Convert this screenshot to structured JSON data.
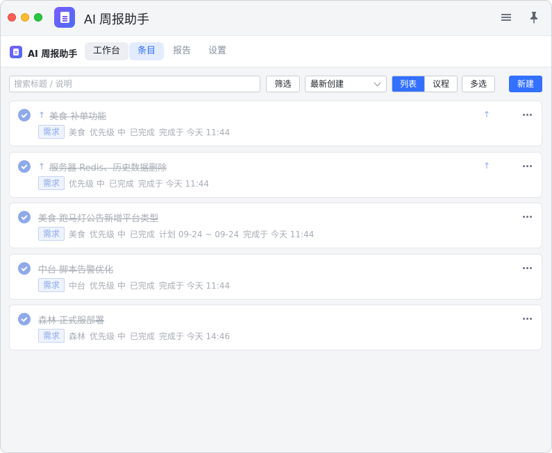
{
  "window": {
    "title": "AI 周报助手"
  },
  "nav": {
    "brand": "AI 周报助手",
    "tabs": [
      {
        "label": "工作台"
      },
      {
        "label": "条目"
      },
      {
        "label": "报告"
      },
      {
        "label": "设置"
      }
    ],
    "active_tab": "条目"
  },
  "toolbar": {
    "search_placeholder": "搜索标题 / 说明",
    "search_value": "",
    "filter_label": "筛选",
    "sort_value": "最新创建",
    "view_list_label": "列表",
    "view_agenda_label": "议程",
    "active_view": "列表",
    "multi_select_label": "多选",
    "new_label": "新建"
  },
  "colors": {
    "accent": "#3370ff",
    "completed_check": "#8fa9ea",
    "muted_text": "#a8adb5"
  },
  "items": [
    {
      "title": "美食 补单功能",
      "pinned": true,
      "tag": "需求",
      "meta": [
        "美食",
        "优先级 中",
        "已完成",
        "完成于 今天 11:44"
      ]
    },
    {
      "title": "服务器 Redis、历史数据删除",
      "pinned": true,
      "tag": "需求",
      "meta": [
        "优先级 中",
        "已完成",
        "完成于 今天 11:44"
      ]
    },
    {
      "title": "美食 跑马灯公告新增平台类型",
      "pinned": false,
      "tag": "需求",
      "meta": [
        "美食",
        "优先级 中",
        "已完成",
        "计划 09-24 ~ 09-24",
        "完成于 今天 11:44"
      ]
    },
    {
      "title": "中台 脚本告警优化",
      "pinned": false,
      "tag": "需求",
      "meta": [
        "中台",
        "优先级 中",
        "已完成",
        "完成于 今天 11:44"
      ]
    },
    {
      "title": "森林 正式服部署",
      "pinned": false,
      "tag": "需求",
      "meta": [
        "森林",
        "优先级 中",
        "已完成",
        "完成于 今天 14:46"
      ]
    }
  ]
}
